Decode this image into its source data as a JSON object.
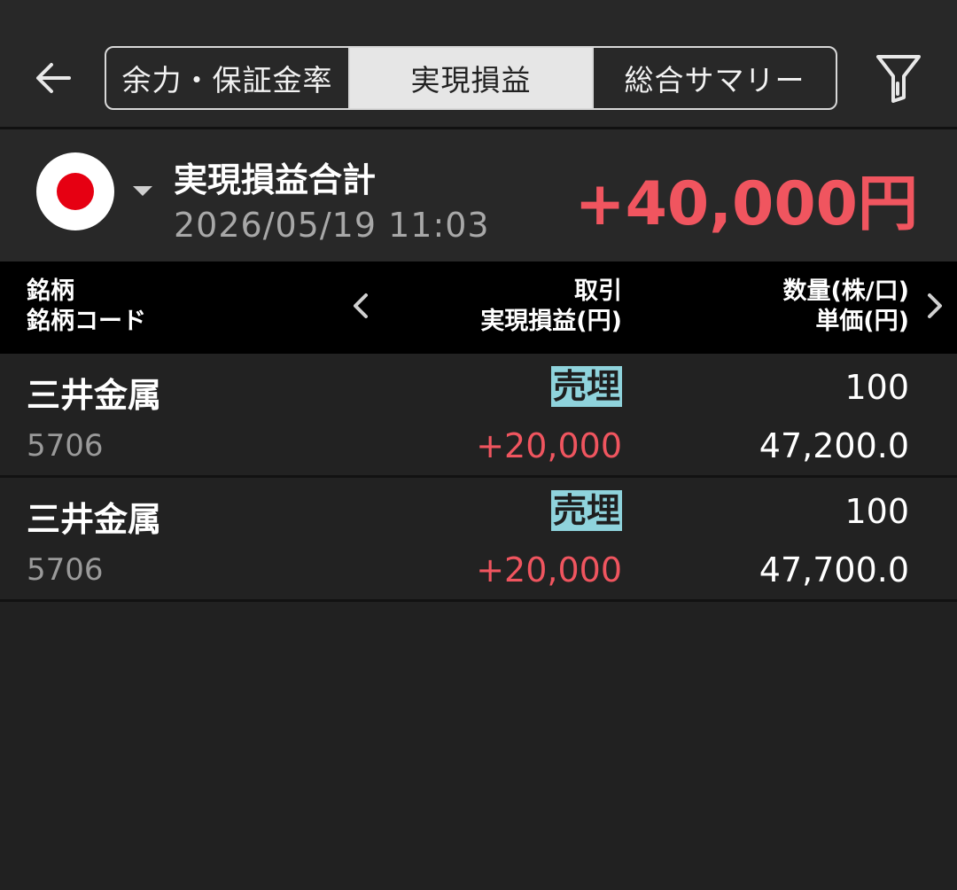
{
  "header": {
    "tabs": [
      {
        "label": "余力・保証金率",
        "active": false
      },
      {
        "label": "実現損益",
        "active": true
      },
      {
        "label": "総合サマリー",
        "active": false
      }
    ],
    "back_icon": "arrow-left-icon",
    "filter_icon": "filter-icon"
  },
  "summary": {
    "market_flag": "japan-flag-icon",
    "title": "実現損益合計",
    "datetime": "2026/05/19  11:03",
    "total": "+40,000円",
    "total_color": "#f0555f"
  },
  "table": {
    "col1": {
      "line1": "銘柄",
      "line2": "銘柄コード"
    },
    "col2": {
      "line1": "取引",
      "line2": "実現損益(円)"
    },
    "col3": {
      "line1": "数量(株/口)",
      "line2": "単価(円)"
    },
    "rows": [
      {
        "name": "三井金属",
        "code": "5706",
        "side": "売埋",
        "pnl": "+20,000",
        "qty": "100",
        "price": "47,200.0"
      },
      {
        "name": "三井金属",
        "code": "5706",
        "side": "売埋",
        "pnl": "+20,000",
        "qty": "100",
        "price": "47,700.0"
      }
    ]
  },
  "colors": {
    "background": "#212121",
    "profit": "#f0555f",
    "side_badge": "#8fd3dc"
  }
}
